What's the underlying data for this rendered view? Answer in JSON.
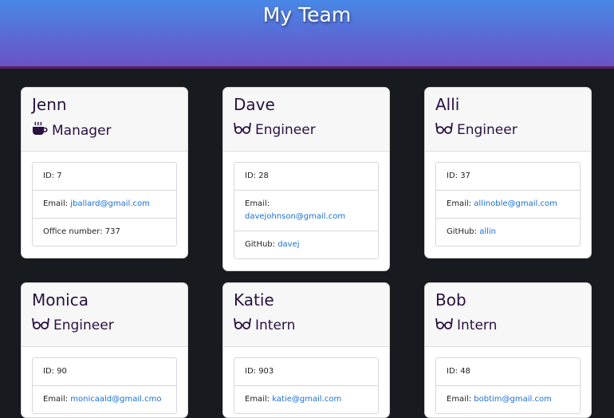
{
  "header": {
    "title": "My Team"
  },
  "cards": [
    {
      "name": "Jenn",
      "role": "Manager",
      "role_icon": "coffee-icon",
      "id_label": "ID: 7",
      "email_label": "Email: ",
      "email": "jballard@gmail.com",
      "extra_label": "Office number: 737",
      "extra_value": ""
    },
    {
      "name": "Dave",
      "role": "Engineer",
      "role_icon": "glasses-icon",
      "id_label": "ID: 28",
      "email_label": "Email: ",
      "email": "davejohnson@gmail.com",
      "extra_label": "GitHub: ",
      "extra_value": "davej"
    },
    {
      "name": "Alli",
      "role": "Engineer",
      "role_icon": "glasses-icon",
      "id_label": "ID: 37",
      "email_label": "Email: ",
      "email": "allinoble@gmail.com",
      "extra_label": "GitHub: ",
      "extra_value": "allin"
    },
    {
      "name": "Monica",
      "role": "Engineer",
      "role_icon": "glasses-icon",
      "id_label": "ID: 90",
      "email_label": "Email: ",
      "email": "monicaald@gmail.cmo"
    },
    {
      "name": "Katie",
      "role": "Intern",
      "role_icon": "glasses-icon",
      "id_label": "ID: 903",
      "email_label": "Email: ",
      "email": "katie@gmail.com"
    },
    {
      "name": "Bob",
      "role": "Intern",
      "role_icon": "glasses-icon",
      "id_label": "ID: 48",
      "email_label": "Email: ",
      "email": "bobtim@gmail.com"
    }
  ],
  "colors": {
    "header_top": "#4888e6",
    "header_bottom": "#6b52c2",
    "name_text": "#2a1140",
    "link": "#1a6fd6",
    "page_bg": "#171a1e"
  }
}
